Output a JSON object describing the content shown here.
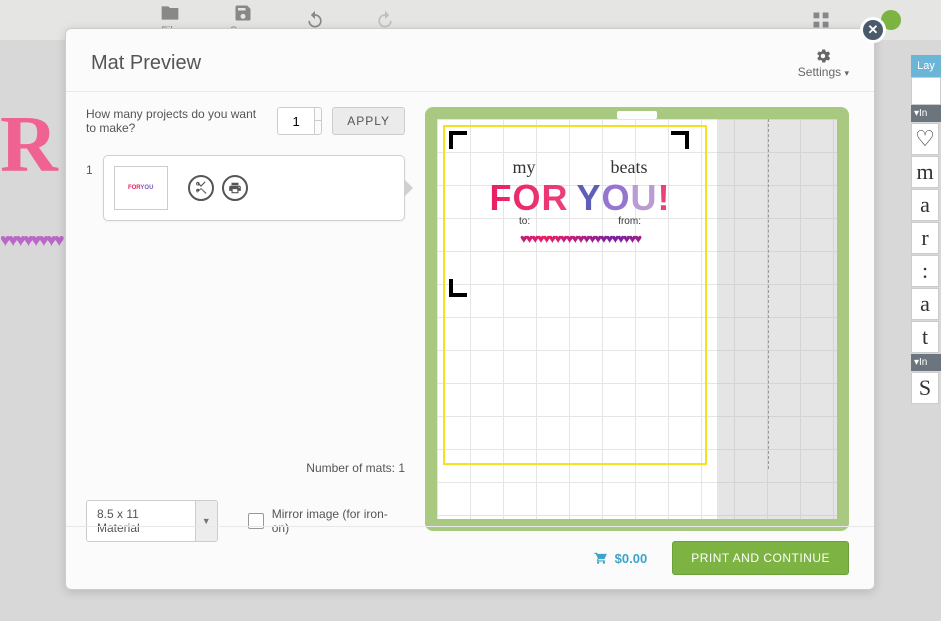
{
  "toolbar": {
    "file": "File",
    "save": "Save"
  },
  "modal": {
    "title": "Mat Preview",
    "settings_label": "Settings",
    "qty_label": "How many projects do you want to make?",
    "qty_value": "1",
    "apply_label": "APPLY",
    "mat_number": "1",
    "mats_count_label": "Number of mats:  1",
    "material_label": "8.5 x 11 Material",
    "mirror_label": "Mirror image (for iron-on)",
    "price": "$0.00",
    "print_label": "PRINT AND CONTINUE"
  },
  "design": {
    "word1": "my",
    "word2": "beats",
    "word3": "FOR",
    "word4_y": "Y",
    "word4_o": "O",
    "word4_u": "U",
    "word4_ex": "!",
    "to_label": "to:",
    "from_label": "from:",
    "hearts": "♥♥♥♥♥♥♥♥♥♥♥♥♥♥♥♥♥♥♥♥♥"
  },
  "sidebar": {
    "layers_tab": "Lay",
    "section1": "In",
    "section2": "In",
    "chars": [
      "♡",
      "m",
      "a",
      "r",
      ":",
      "a",
      "t",
      "S"
    ]
  },
  "bg": {
    "big_letter": "R",
    "hearts": "♥♥♥♥♥♥♥♥"
  }
}
